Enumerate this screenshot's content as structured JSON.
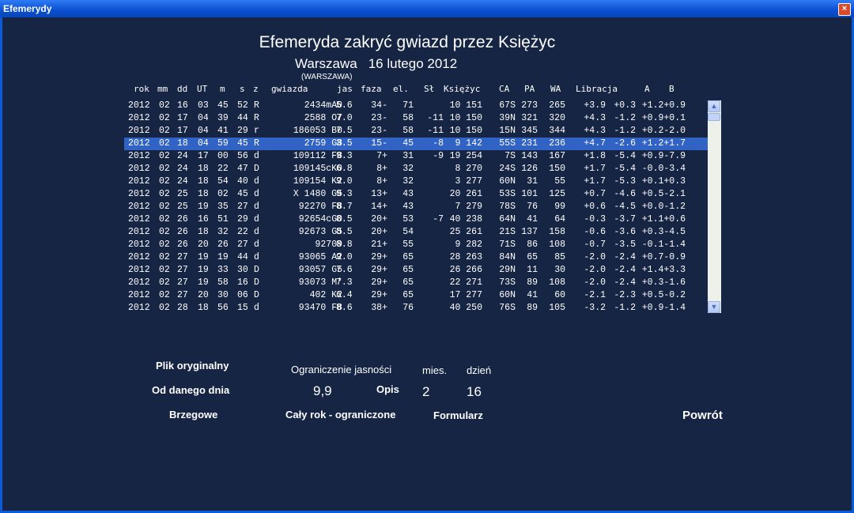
{
  "window": {
    "title": "Efemerydy",
    "close_glyph": "×"
  },
  "heading": {
    "title": "Efemeryda zakryć gwiazd przez Księżyc",
    "city": "Warszawa",
    "date": "16 lutego 2012",
    "station": "(WARSZAWA)"
  },
  "columns": [
    "rok",
    "mm",
    "dd",
    "UT",
    "m",
    "s",
    "z",
    "gwiazda",
    "jas",
    "faza",
    "el.",
    "Sł",
    "Księżyc",
    "CA",
    "PA",
    "WA",
    "Libracja",
    "A",
    "B"
  ],
  "rows": [
    [
      "2012",
      "02",
      "16",
      "03",
      "45",
      "52",
      "R",
      "2434mA0",
      "5.6",
      "34-",
      "71",
      "",
      "10 151",
      "67S",
      "273",
      "265",
      "+3.9",
      "+0.3",
      "+1.2+0.9"
    ],
    [
      "2012",
      "02",
      "17",
      "04",
      "39",
      "44",
      "R",
      "2588 O7",
      "7.0",
      "23-",
      "58",
      "-11",
      "10 150",
      "39N",
      "321",
      "320",
      "+4.3",
      "-1.2",
      "+0.9+0.1"
    ],
    [
      "2012",
      "02",
      "17",
      "04",
      "41",
      "29",
      "r",
      "186053 B0",
      "7.5",
      "23-",
      "58",
      "-11",
      "10 150",
      "15N",
      "345",
      "344",
      "+4.3",
      "-1.2",
      "+0.2-2.0"
    ],
    [
      "2012",
      "02",
      "18",
      "04",
      "59",
      "45",
      "R",
      "2759 G8",
      "3.5",
      "15-",
      "45",
      "-8",
      "9 142",
      "55S",
      "231",
      "236",
      "+4.7",
      "-2.6",
      "+1.2+1.7"
    ],
    [
      "2012",
      "02",
      "24",
      "17",
      "00",
      "56",
      "d",
      "109112 F8",
      "9.3",
      "7+",
      "31",
      "-9",
      "19 254",
      "7S",
      "143",
      "167",
      "+1.8",
      "-5.4",
      "+0.9-7.9"
    ],
    [
      "2012",
      "02",
      "24",
      "18",
      "22",
      "47",
      "D",
      "109145cK0",
      "6.8",
      "8+",
      "32",
      "",
      "8 270",
      "24S",
      "126",
      "150",
      "+1.7",
      "-5.4",
      "-0.0-3.4"
    ],
    [
      "2012",
      "02",
      "24",
      "18",
      "54",
      "40",
      "d",
      "109154 K2",
      "9.0",
      "8+",
      "32",
      "",
      "3 277",
      "60N",
      "31",
      "55",
      "+1.7",
      "-5.3",
      "+0.1+0.3"
    ],
    [
      "2012",
      "02",
      "25",
      "18",
      "02",
      "45",
      "d",
      "X 1480 G5",
      "9.3",
      "13+",
      "43",
      "",
      "20 261",
      "53S",
      "101",
      "125",
      "+0.7",
      "-4.6",
      "+0.5-2.1"
    ],
    [
      "2012",
      "02",
      "25",
      "19",
      "35",
      "27",
      "d",
      "92270 F8",
      "8.7",
      "14+",
      "43",
      "",
      "7 279",
      "78S",
      "76",
      "99",
      "+0.6",
      "-4.5",
      "+0.0-1.2"
    ],
    [
      "2012",
      "02",
      "26",
      "16",
      "51",
      "29",
      "d",
      "92654cG0",
      "8.5",
      "20+",
      "53",
      "-7",
      "40 238",
      "64N",
      "41",
      "64",
      "-0.3",
      "-3.7",
      "+1.1+0.6"
    ],
    [
      "2012",
      "02",
      "26",
      "18",
      "32",
      "22",
      "d",
      "92673 G5",
      "8.5",
      "20+",
      "54",
      "",
      "25 261",
      "21S",
      "137",
      "158",
      "-0.6",
      "-3.6",
      "+0.3-4.5"
    ],
    [
      "2012",
      "02",
      "26",
      "20",
      "26",
      "27",
      "d",
      "92709",
      "8.8",
      "21+",
      "55",
      "",
      "9 282",
      "71S",
      "86",
      "108",
      "-0.7",
      "-3.5",
      "-0.1-1.4"
    ],
    [
      "2012",
      "02",
      "27",
      "19",
      "19",
      "44",
      "d",
      "93065 A2",
      "9.0",
      "29+",
      "65",
      "",
      "28 263",
      "84N",
      "65",
      "85",
      "-2.0",
      "-2.4",
      "+0.7-0.9"
    ],
    [
      "2012",
      "02",
      "27",
      "19",
      "33",
      "30",
      "D",
      "93057 G5",
      "7.6",
      "29+",
      "65",
      "",
      "26 266",
      "29N",
      "11",
      "30",
      "-2.0",
      "-2.4",
      "+1.4+3.3"
    ],
    [
      "2012",
      "02",
      "27",
      "19",
      "58",
      "16",
      "D",
      "93073 M*",
      "7.3",
      "29+",
      "65",
      "",
      "22 271",
      "73S",
      "89",
      "108",
      "-2.0",
      "-2.4",
      "+0.3-1.6"
    ],
    [
      "2012",
      "02",
      "27",
      "20",
      "30",
      "06",
      "D",
      "402 K2",
      "6.4",
      "29+",
      "65",
      "",
      "17 277",
      "60N",
      "41",
      "60",
      "-2.1",
      "-2.3",
      "+0.5-0.2"
    ],
    [
      "2012",
      "02",
      "28",
      "18",
      "56",
      "15",
      "d",
      "93470 F8",
      "8.6",
      "38+",
      "76",
      "",
      "40 250",
      "76S",
      "89",
      "105",
      "-3.2",
      "-1.2",
      "+0.9-1.4"
    ]
  ],
  "selected_row": 3,
  "scrollbar": {
    "up_glyph": "▲",
    "down_glyph": "▼"
  },
  "controls": {
    "plik_oryginalny": "Plik oryginalny",
    "od_danego_dnia": "Od danego dnia",
    "brzegowe": "Brzegowe",
    "ograniczenie_label": "Ograniczenie jasności",
    "ograniczenie_value": "9,9",
    "opis": "Opis",
    "caly_rok": "Cały rok - ograniczone",
    "mies_label": "mies.",
    "mies_value": "2",
    "dzien_label": "dzień",
    "dzien_value": "16",
    "formularz": "Formularz",
    "powrot": "Powrót"
  }
}
